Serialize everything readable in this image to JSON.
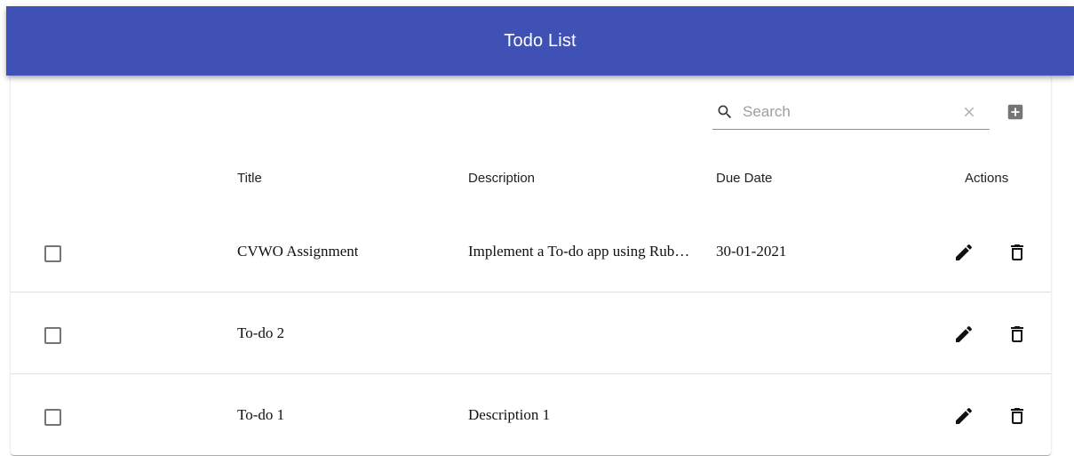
{
  "appbar": {
    "title": "Todo List"
  },
  "toolbar": {
    "search_placeholder": "Search",
    "search_value": "",
    "icons": {
      "search": "search-icon",
      "clear": "close-icon",
      "add": "add-box-icon"
    }
  },
  "table": {
    "columns": [
      "Title",
      "Description",
      "Due Date",
      "Actions"
    ],
    "rows": [
      {
        "checked": false,
        "title": "CVWO Assignment",
        "description": "Implement a To-do app using Ruby on Rails",
        "due_date": "30-01-2021"
      },
      {
        "checked": false,
        "title": "To-do 2",
        "description": "",
        "due_date": ""
      },
      {
        "checked": false,
        "title": "To-do 1",
        "description": "Description 1",
        "due_date": ""
      }
    ],
    "row_action_icons": [
      "edit-icon",
      "delete-icon"
    ]
  },
  "colors": {
    "appbar": "#3f51b5",
    "text": "#222222",
    "divider": "#e0e0e0"
  }
}
